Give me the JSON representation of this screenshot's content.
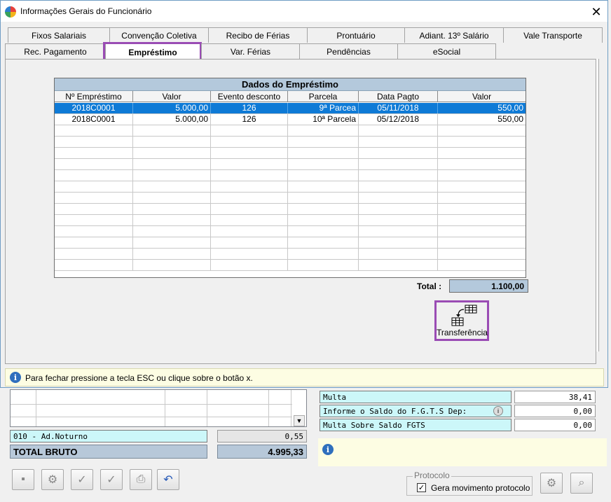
{
  "window": {
    "title": "Informações Gerais do Funcionário",
    "close": "✕"
  },
  "tabs_row1": [
    "Fixos Salariais",
    "Convenção Coletiva",
    "Recibo de Férias",
    "Prontuário",
    "Adiant. 13º Salário",
    "Vale Transporte"
  ],
  "tabs_row2": [
    "Rec. Pagamento",
    "Empréstimo",
    "Var. Férias",
    "Pendências",
    "eSocial"
  ],
  "active_tab": "Empréstimo",
  "grid": {
    "caption": "Dados do Empréstimo",
    "columns": [
      "Nº Empréstimo",
      "Valor",
      "Evento desconto",
      "Parcela",
      "Data Pagto",
      "Valor"
    ],
    "rows": [
      [
        "2018C0001",
        "5.000,00",
        "126",
        "9ª Parcea",
        "05/11/2018",
        "550,00"
      ],
      [
        "2018C0001",
        "5.000,00",
        "126",
        "10ª Parcela",
        "05/12/2018",
        "550,00"
      ]
    ],
    "selected_row": 0
  },
  "total": {
    "label": "Total :",
    "value": "1.100,00"
  },
  "transfer_button": {
    "label": "Transferência",
    "icon": "table-transfer-icon"
  },
  "status": {
    "text": "Para fechar pressione a tecla ESC ou clique sobre o botão x."
  },
  "background": {
    "item_line": {
      "label": "010 - Ad.Noturno",
      "value": "0,55"
    },
    "total_bruto": {
      "label": "TOTAL BRUTO",
      "value": "4.995,33"
    },
    "right_fields": [
      {
        "label": "Multa",
        "value": "38,41"
      },
      {
        "label": "Informe o Saldo do F.G.T.S Dep:",
        "value": "0,00"
      },
      {
        "label": "Multa Sobre Saldo FGTS",
        "value": "0,00"
      }
    ],
    "protocolo": {
      "legend": "Protocolo",
      "checkbox_label": "Gera movimento protocolo",
      "checked": true
    }
  },
  "colors": {
    "accent_highlight": "#9a4cb4",
    "selection": "#0e7ad6",
    "caption_bg": "#b4c9dc",
    "info_bg": "#fdfde3"
  }
}
